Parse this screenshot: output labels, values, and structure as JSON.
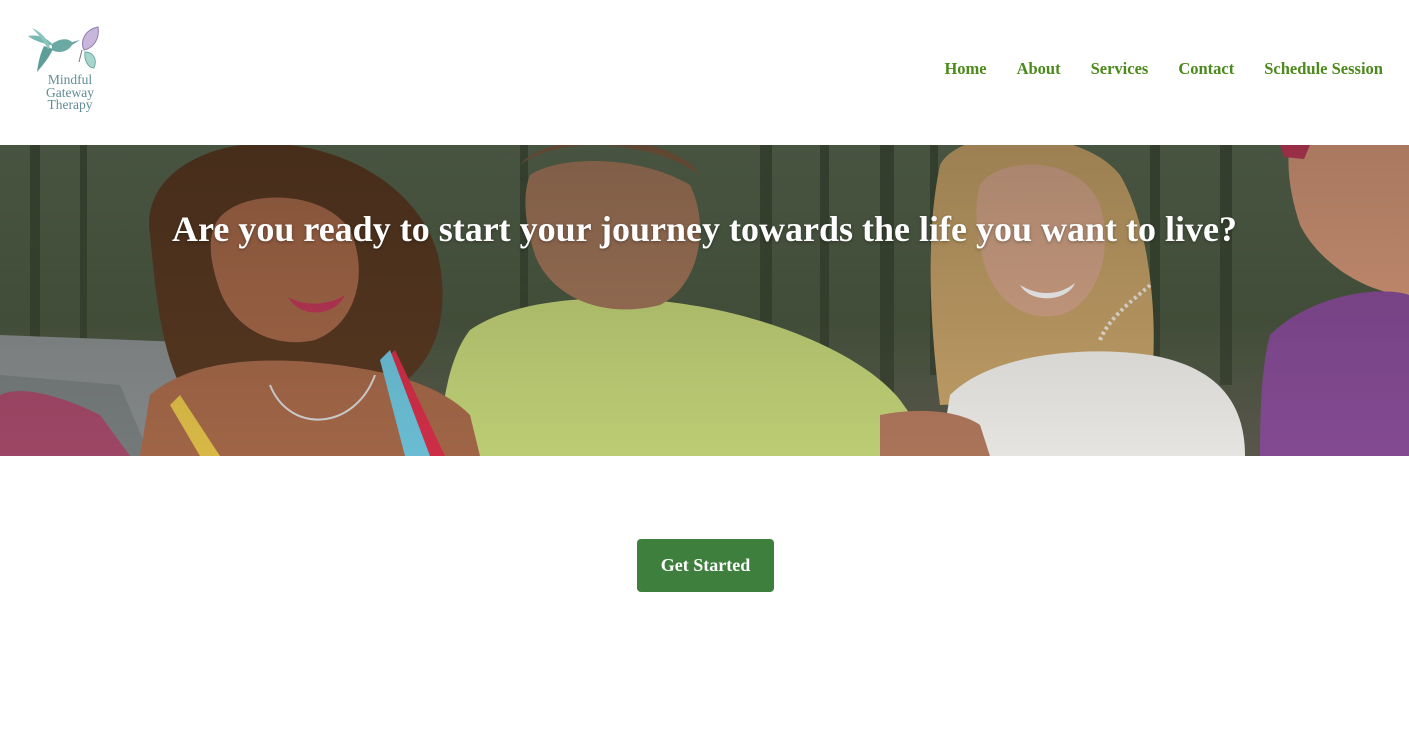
{
  "header": {
    "logo": {
      "icon": "hummingbird-butterfly-logo",
      "text_lines": [
        "Mindful",
        "Gateway",
        "Therapy"
      ],
      "color": "#5f8d96"
    },
    "nav": {
      "color": "#4c8a1c",
      "items": [
        {
          "label": "Home"
        },
        {
          "label": "About"
        },
        {
          "label": "Services"
        },
        {
          "label": "Contact"
        },
        {
          "label": "Schedule Session"
        }
      ]
    }
  },
  "hero": {
    "title": "Are you ready to start your journey towards the life you want to live?",
    "background": "group-of-friends-laughing-forest-road-photo"
  },
  "cta": {
    "label": "Get Started",
    "color": "#3e7f3e"
  }
}
